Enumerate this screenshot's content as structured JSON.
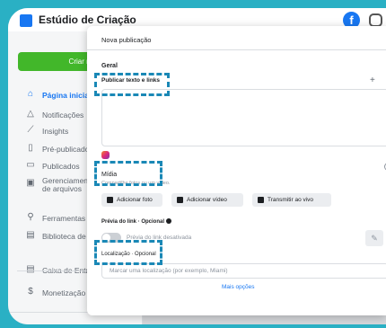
{
  "app": {
    "title": "Estúdio de Criação",
    "fb_letter": "f"
  },
  "sidebar": {
    "create_button": "Criar nova",
    "items": [
      {
        "label": "Página inicial",
        "icon": "home-icon",
        "glyph": "⌂",
        "active": true
      },
      {
        "label": "Notificações",
        "icon": "bell-icon",
        "glyph": "△",
        "active": false
      },
      {
        "label": "Insights",
        "icon": "insights-icon",
        "glyph": "⟋",
        "active": false
      },
      {
        "label": "Pré-publicados",
        "icon": "document-icon",
        "glyph": "▯",
        "active": false
      },
      {
        "label": "Publicados",
        "icon": "calendar-icon",
        "glyph": "▭",
        "active": false
      },
      {
        "label": "Gerenciamento de arquivos",
        "icon": "folder-icon",
        "glyph": "▣",
        "active": false
      },
      {
        "label": "Ferramentas",
        "icon": "tools-icon",
        "glyph": "⚲",
        "active": false
      },
      {
        "label": "Biblioteca de c",
        "icon": "library-icon",
        "glyph": "▤",
        "active": false
      },
      {
        "label": "Caixa de Entrada",
        "icon": "inbox-icon",
        "glyph": "▤",
        "active": false
      },
      {
        "label": "Monetização",
        "icon": "money-icon",
        "glyph": "$",
        "active": false
      }
    ]
  },
  "modal": {
    "title": "Nova publicação",
    "section_general": "Geral",
    "publish_label": "Publicar texto e links",
    "media_label": "Mídia",
    "media_sub": "Compartilhe fotos ou um vídeo.",
    "buttons": {
      "add_photo": "Adicionar foto",
      "add_video": "Adicionar vídeo",
      "live": "Transmitir ao vivo"
    },
    "link_preview_label": "Prévia do link · Opcional",
    "link_preview_toggle": "Prévia do link desativada",
    "location_label": "Localização · Opcional",
    "location_placeholder": "Marcar uma localização (por exemplo, Miami)",
    "more": "Mais opções"
  },
  "colors": {
    "accent": "#1877f2",
    "create_button": "#42b72a",
    "highlight": "#1a88b6",
    "frame": "#2ab0c4"
  }
}
